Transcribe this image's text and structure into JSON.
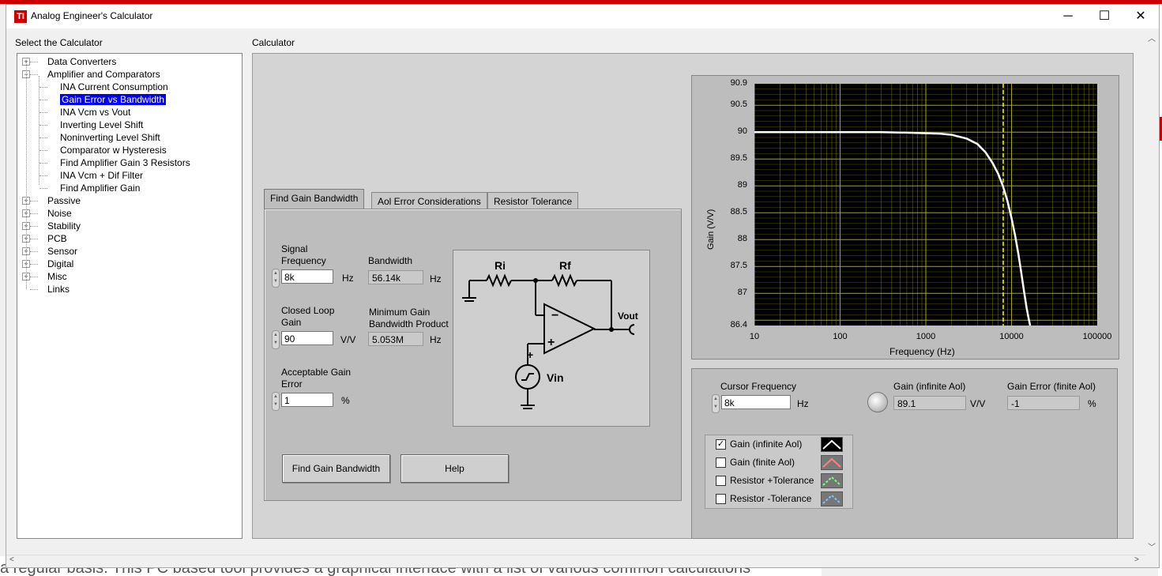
{
  "window": {
    "title": "Analog Engineer's Calculator",
    "minimize": "─",
    "maximize": "☐",
    "close": "✕"
  },
  "background": {
    "bottom_text": "a regular basis. This PC based tool provides a graphical interface with a list of various common calculations"
  },
  "left_panel": {
    "label": "Select the Calculator"
  },
  "tree": {
    "items": [
      {
        "label": "Data Converters",
        "level": 0,
        "expander": "+"
      },
      {
        "label": "Amplifier and Comparators",
        "level": 0,
        "expander": "−"
      },
      {
        "label": "INA Current Consumption",
        "level": 1
      },
      {
        "label": "Gain Error vs Bandwidth",
        "level": 1,
        "selected": true
      },
      {
        "label": "INA Vcm vs Vout",
        "level": 1
      },
      {
        "label": "Inverting Level Shift",
        "level": 1
      },
      {
        "label": "Noninverting Level Shift",
        "level": 1
      },
      {
        "label": "Comparator w Hysteresis",
        "level": 1
      },
      {
        "label": "Find Amplifier Gain 3 Resistors",
        "level": 1
      },
      {
        "label": "INA Vcm + Dif Filter",
        "level": 1
      },
      {
        "label": "Find Amplifier Gain",
        "level": 1
      },
      {
        "label": "Passive",
        "level": 0,
        "expander": "+"
      },
      {
        "label": "Noise",
        "level": 0,
        "expander": "+"
      },
      {
        "label": "Stability",
        "level": 0,
        "expander": "+"
      },
      {
        "label": "PCB",
        "level": 0,
        "expander": "+"
      },
      {
        "label": "Sensor",
        "level": 0,
        "expander": "+"
      },
      {
        "label": "Digital",
        "level": 0,
        "expander": "+"
      },
      {
        "label": "Misc",
        "level": 0,
        "expander": "+"
      },
      {
        "label": "Links",
        "level": 0
      }
    ]
  },
  "calculator": {
    "label": "Calculator",
    "tabs": [
      "Find Gain Bandwidth",
      "Aol Error Considerations",
      "Resistor Tolerance"
    ],
    "signal_frequency": {
      "label1": "Signal",
      "label2": "Frequency",
      "value": "8k",
      "unit": "Hz"
    },
    "bandwidth": {
      "label": "Bandwidth",
      "value": "56.14k",
      "unit": "Hz"
    },
    "closed_loop_gain": {
      "label1": "Closed Loop",
      "label2": "Gain",
      "value": "90",
      "unit": "V/V"
    },
    "min_gbw": {
      "label1": "Minimum Gain",
      "label2": "Bandwidth Product",
      "value": "5.053M",
      "unit": "Hz"
    },
    "acceptable_gain_error": {
      "label1": "Acceptable Gain",
      "label2": "Error",
      "value": "1",
      "unit": "%"
    },
    "buttons": {
      "find": "Find Gain Bandwidth",
      "help": "Help"
    },
    "circuit": {
      "ri": "Ri",
      "rf": "Rf",
      "vout": "Vout",
      "vin": "Vin",
      "minus": "−",
      "plus": "+"
    }
  },
  "cursor": {
    "freq_label": "Cursor Frequency",
    "freq_value": "8k",
    "freq_unit": "Hz",
    "gain_inf_label": "Gain (infinite Aol)",
    "gain_inf_value": "89.1",
    "gain_inf_unit": "V/V",
    "gain_err_label": "Gain Error (finite Aol)",
    "gain_err_value": "-1",
    "gain_err_unit": "%"
  },
  "legend": [
    {
      "label": "Gain (infinite  Aol)",
      "checked": true,
      "color": "#ffffff"
    },
    {
      "label": "Gain (finite Aol)",
      "checked": false,
      "color": "#ff8080"
    },
    {
      "label": "Resistor +Tolerance",
      "checked": false,
      "color": "#80ff80"
    },
    {
      "label": "Resistor -Tolerance",
      "checked": false,
      "color": "#80c0ff"
    }
  ],
  "colors": {
    "plot_bg": "#000000",
    "grid": "#b5b520",
    "curve": "#ffffff",
    "cursor": "#ffff00",
    "selection": "#0000ee"
  },
  "chart_data": {
    "type": "line",
    "title": "",
    "xlabel": "Frequency (Hz)",
    "ylabel": "Gain (V/V)",
    "x_scale": "log",
    "xlim": [
      10,
      100000
    ],
    "ylim": [
      86.4,
      90.9
    ],
    "x_ticks": [
      "10",
      "100",
      "1000",
      "10000",
      "100000"
    ],
    "y_ticks": [
      "90.9",
      "90.5",
      "90",
      "89.5",
      "89",
      "88.5",
      "88",
      "87.5",
      "87",
      "86.4"
    ],
    "grid": true,
    "cursor_x": 8000,
    "series": [
      {
        "x": [
          10,
          100,
          300,
          600,
          1000,
          1500,
          2000,
          3000,
          4000,
          5000,
          6000,
          7000,
          8000,
          9000,
          10000,
          11000,
          12000,
          13000,
          14000,
          15000,
          16000,
          16500
        ],
        "values": [
          90.0,
          90.0,
          90.0,
          89.99,
          89.98,
          89.97,
          89.95,
          89.88,
          89.78,
          89.62,
          89.43,
          89.22,
          88.98,
          88.71,
          88.4,
          88.08,
          87.74,
          87.38,
          87.03,
          86.73,
          86.5,
          86.4
        ]
      }
    ]
  }
}
